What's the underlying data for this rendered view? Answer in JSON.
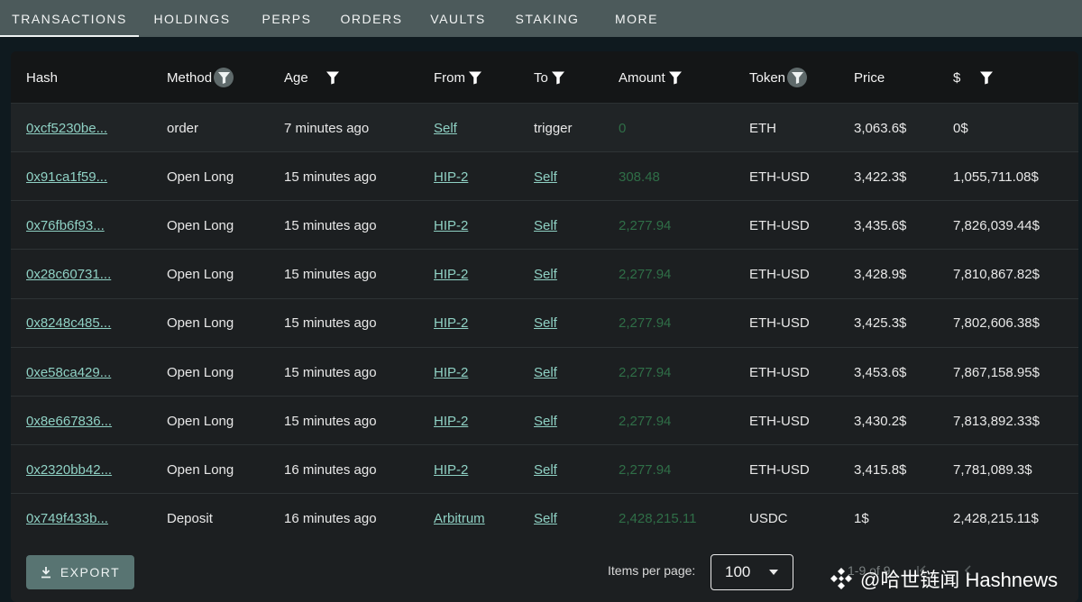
{
  "tabs": [
    "TRANSACTIONS",
    "HOLDINGS",
    "PERPS",
    "ORDERS",
    "VAULTS",
    "STAKING",
    "MORE"
  ],
  "active_tab": "TRANSACTIONS",
  "columns": [
    "Hash",
    "Method",
    "Age",
    "From",
    "To",
    "Amount",
    "Token",
    "Price",
    "$"
  ],
  "rows": [
    {
      "hash": "0xcf5230be...",
      "method": "order",
      "age": "7 minutes ago",
      "from": "Self",
      "to": "trigger",
      "amount": "0",
      "token": "ETH",
      "price": "3,063.6$",
      "usd": "0$"
    },
    {
      "hash": "0x91ca1f59...",
      "method": "Open Long",
      "age": "15 minutes ago",
      "from": "HIP-2",
      "to": "Self",
      "amount": "308.48",
      "token": "ETH-USD",
      "price": "3,422.3$",
      "usd": "1,055,711.08$"
    },
    {
      "hash": "0x76fb6f93...",
      "method": "Open Long",
      "age": "15 minutes ago",
      "from": "HIP-2",
      "to": "Self",
      "amount": "2,277.94",
      "token": "ETH-USD",
      "price": "3,435.6$",
      "usd": "7,826,039.44$"
    },
    {
      "hash": "0x28c60731...",
      "method": "Open Long",
      "age": "15 minutes ago",
      "from": "HIP-2",
      "to": "Self",
      "amount": "2,277.94",
      "token": "ETH-USD",
      "price": "3,428.9$",
      "usd": "7,810,867.82$"
    },
    {
      "hash": "0x8248c485...",
      "method": "Open Long",
      "age": "15 minutes ago",
      "from": "HIP-2",
      "to": "Self",
      "amount": "2,277.94",
      "token": "ETH-USD",
      "price": "3,425.3$",
      "usd": "7,802,606.38$"
    },
    {
      "hash": "0xe58ca429...",
      "method": "Open Long",
      "age": "15 minutes ago",
      "from": "HIP-2",
      "to": "Self",
      "amount": "2,277.94",
      "token": "ETH-USD",
      "price": "3,453.6$",
      "usd": "7,867,158.95$"
    },
    {
      "hash": "0x8e667836...",
      "method": "Open Long",
      "age": "15 minutes ago",
      "from": "HIP-2",
      "to": "Self",
      "amount": "2,277.94",
      "token": "ETH-USD",
      "price": "3,430.2$",
      "usd": "7,813,892.33$"
    },
    {
      "hash": "0x2320bb42...",
      "method": "Open Long",
      "age": "16 minutes ago",
      "from": "HIP-2",
      "to": "Self",
      "amount": "2,277.94",
      "token": "ETH-USD",
      "price": "3,415.8$",
      "usd": "7,781,089.3$"
    },
    {
      "hash": "0x749f433b...",
      "method": "Deposit",
      "age": "16 minutes ago",
      "from": "Arbitrum",
      "to": "Self",
      "amount": "2,428,215.11",
      "token": "USDC",
      "price": "1$",
      "usd": "2,428,215.11$"
    }
  ],
  "footer": {
    "export_label": "EXPORT",
    "items_per_page_label": "Items per page:",
    "items_per_page_value": "100",
    "range_text": "1-9 of 9"
  },
  "watermark": "@哈世链闻 Hashnews",
  "colors": {
    "tabbar": "#4c5a5b",
    "link": "#8fd1c4",
    "amount": "#2f6e47",
    "export_button": "#587472"
  }
}
